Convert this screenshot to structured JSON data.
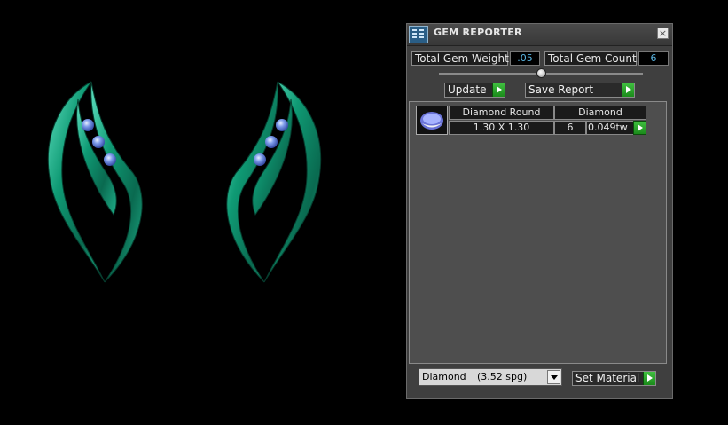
{
  "window": {
    "title": "GEM REPORTER",
    "close_label": "×"
  },
  "summary": {
    "weight_label": "Total Gem Weight",
    "weight_value": ".05",
    "count_label": "Total Gem Count",
    "count_value": "6"
  },
  "slider": {
    "position": 0.5
  },
  "toolbar": {
    "update_label": "Update",
    "save_label": "Save Report"
  },
  "gem_list": [
    {
      "name": "Diamond Round",
      "size": "1.30 X 1.30",
      "material": "Diamond",
      "count": "6",
      "weight": "0.049tw"
    }
  ],
  "material_select": {
    "name": "Diamond",
    "spg": "(3.52 spg)"
  },
  "set_material_label": "Set Material",
  "colors": {
    "panel": "#3f3f3f",
    "list_background": "#4e4e4e",
    "accent_green": "#2aa52a",
    "value_text": "#5ab4e0",
    "gem_metal": "#0f8a68",
    "gem_stone": "#5b7fe0"
  },
  "icons": {
    "app": "gem-reporter-icon",
    "close": "close-icon",
    "arrow": "green-play-arrow-icon",
    "dropdown": "chevron-down-icon",
    "thumb": "round-diamond-icon"
  }
}
